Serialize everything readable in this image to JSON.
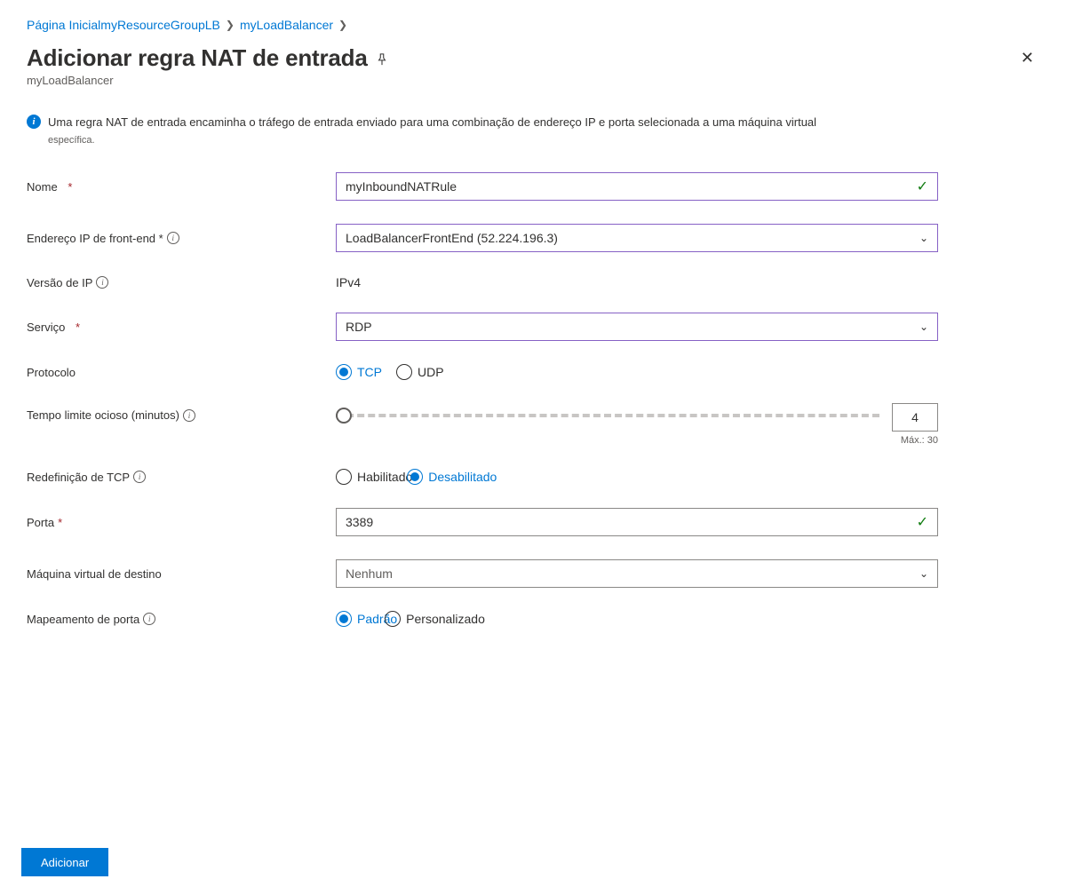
{
  "breadcrumb": {
    "home": "Página Inicial",
    "group": "myResourceGroupLB",
    "resource": "myLoadBalancer"
  },
  "header": {
    "title": "Adicionar regra NAT de entrada",
    "subtitle": "myLoadBalancer"
  },
  "info": {
    "text": "Uma regra NAT de entrada encaminha o tráfego de entrada enviado para uma combinação de endereço IP e porta selecionada a uma máquina virtual",
    "sub": "específica."
  },
  "form": {
    "name": {
      "label": "Nome",
      "value": "myInboundNATRule"
    },
    "frontend": {
      "label": "Endereço IP de front-end *",
      "value": "LoadBalancerFrontEnd (52.224.196.3)"
    },
    "ipversion": {
      "label": "Versão de IP",
      "value": "IPv4"
    },
    "service": {
      "label": "Serviço",
      "value": "RDP"
    },
    "protocol": {
      "label": "Protocolo",
      "tcp": "TCP",
      "udp": "UDP"
    },
    "idle": {
      "label": "Tempo limite ocioso (minutos)",
      "value": "4",
      "max": "Máx.: 30"
    },
    "tcpreset": {
      "label": "Redefinição de TCP",
      "enabled": "Habilitado",
      "disabled": "Desabilitado"
    },
    "port": {
      "label": "Porta",
      "value": "3389"
    },
    "targetvm": {
      "label": "Máquina virtual de destino",
      "value": "Nenhum"
    },
    "portmap": {
      "label": "Mapeamento de porta",
      "default": "Padrão",
      "custom": "Personalizado"
    }
  },
  "footer": {
    "add": "Adicionar"
  }
}
